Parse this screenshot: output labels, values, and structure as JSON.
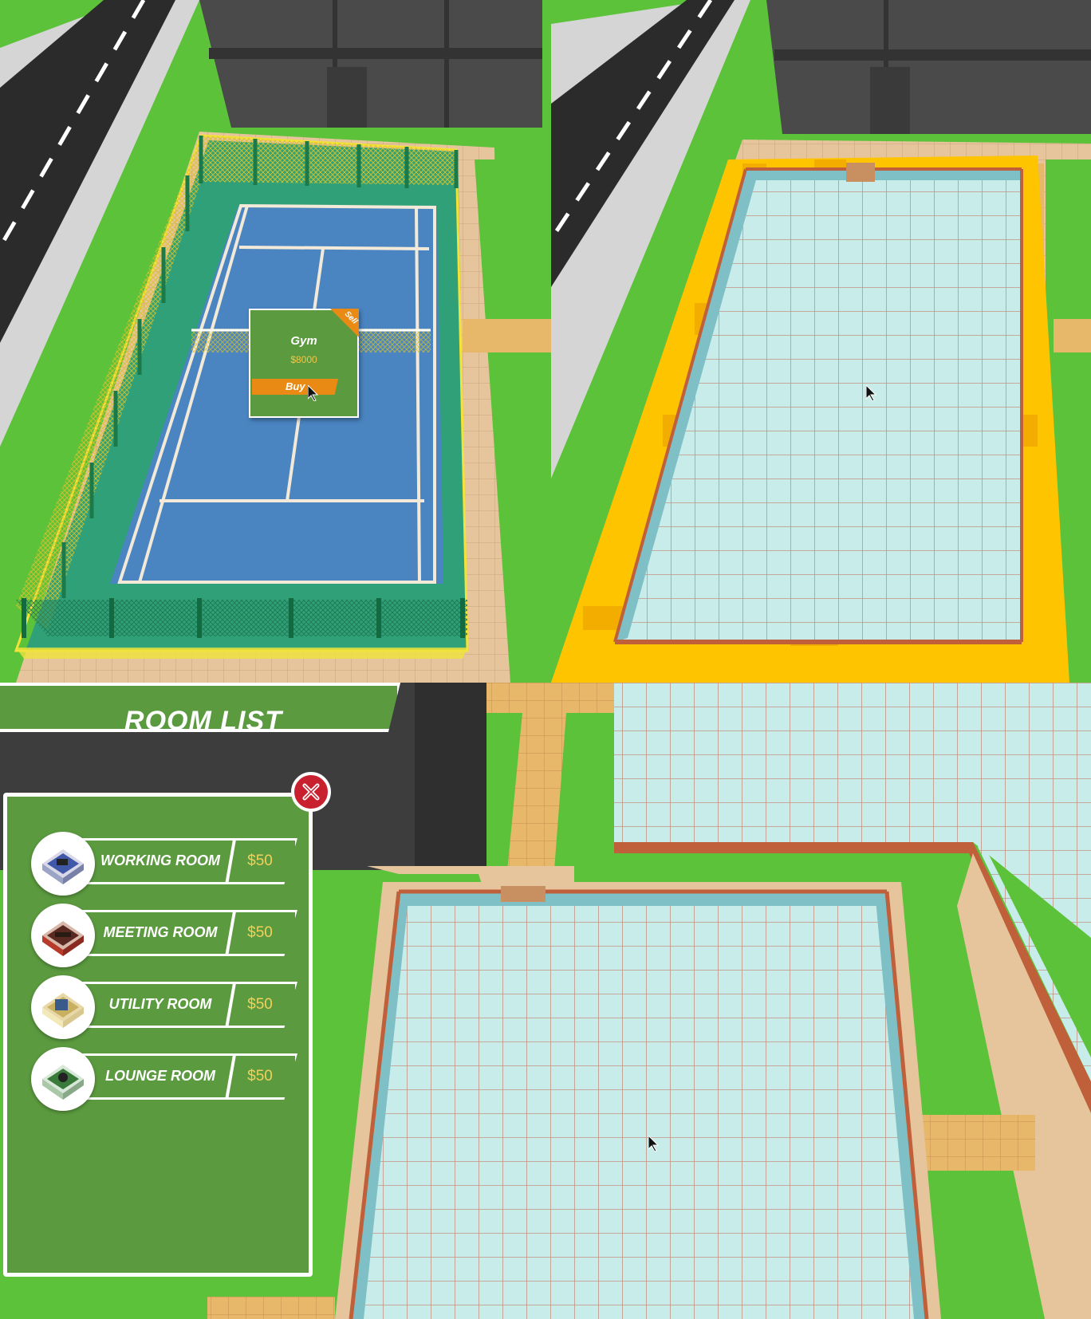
{
  "gym_popup": {
    "title": "Gym",
    "price": "$8000",
    "buy_label": "Buy",
    "sell_label": "Sell"
  },
  "room_list": {
    "title": "ROOM LIST",
    "close_icon": "close-x-icon",
    "rooms": [
      {
        "name": "WORKING ROOM",
        "price": "$50",
        "icon": "working-room-thumbnail"
      },
      {
        "name": "MEETING ROOM",
        "price": "$50",
        "icon": "meeting-room-thumbnail"
      },
      {
        "name": "UTILITY ROOM",
        "price": "$50",
        "icon": "utility-room-thumbnail"
      },
      {
        "name": "LOUNGE ROOM",
        "price": "$50",
        "icon": "lounge-room-thumbnail"
      }
    ]
  },
  "colors": {
    "grass": "#5cc23a",
    "court_blue": "#4a85c1",
    "court_green": "#2fa078",
    "tile": "#bfe8e4",
    "wall_brick": "#c0603a",
    "highlight_yellow": "#ffc400",
    "ui_green": "#5b9a3f",
    "buy_orange": "#e98a14",
    "close_red": "#c8202e",
    "price_gold": "#f3d05a"
  }
}
